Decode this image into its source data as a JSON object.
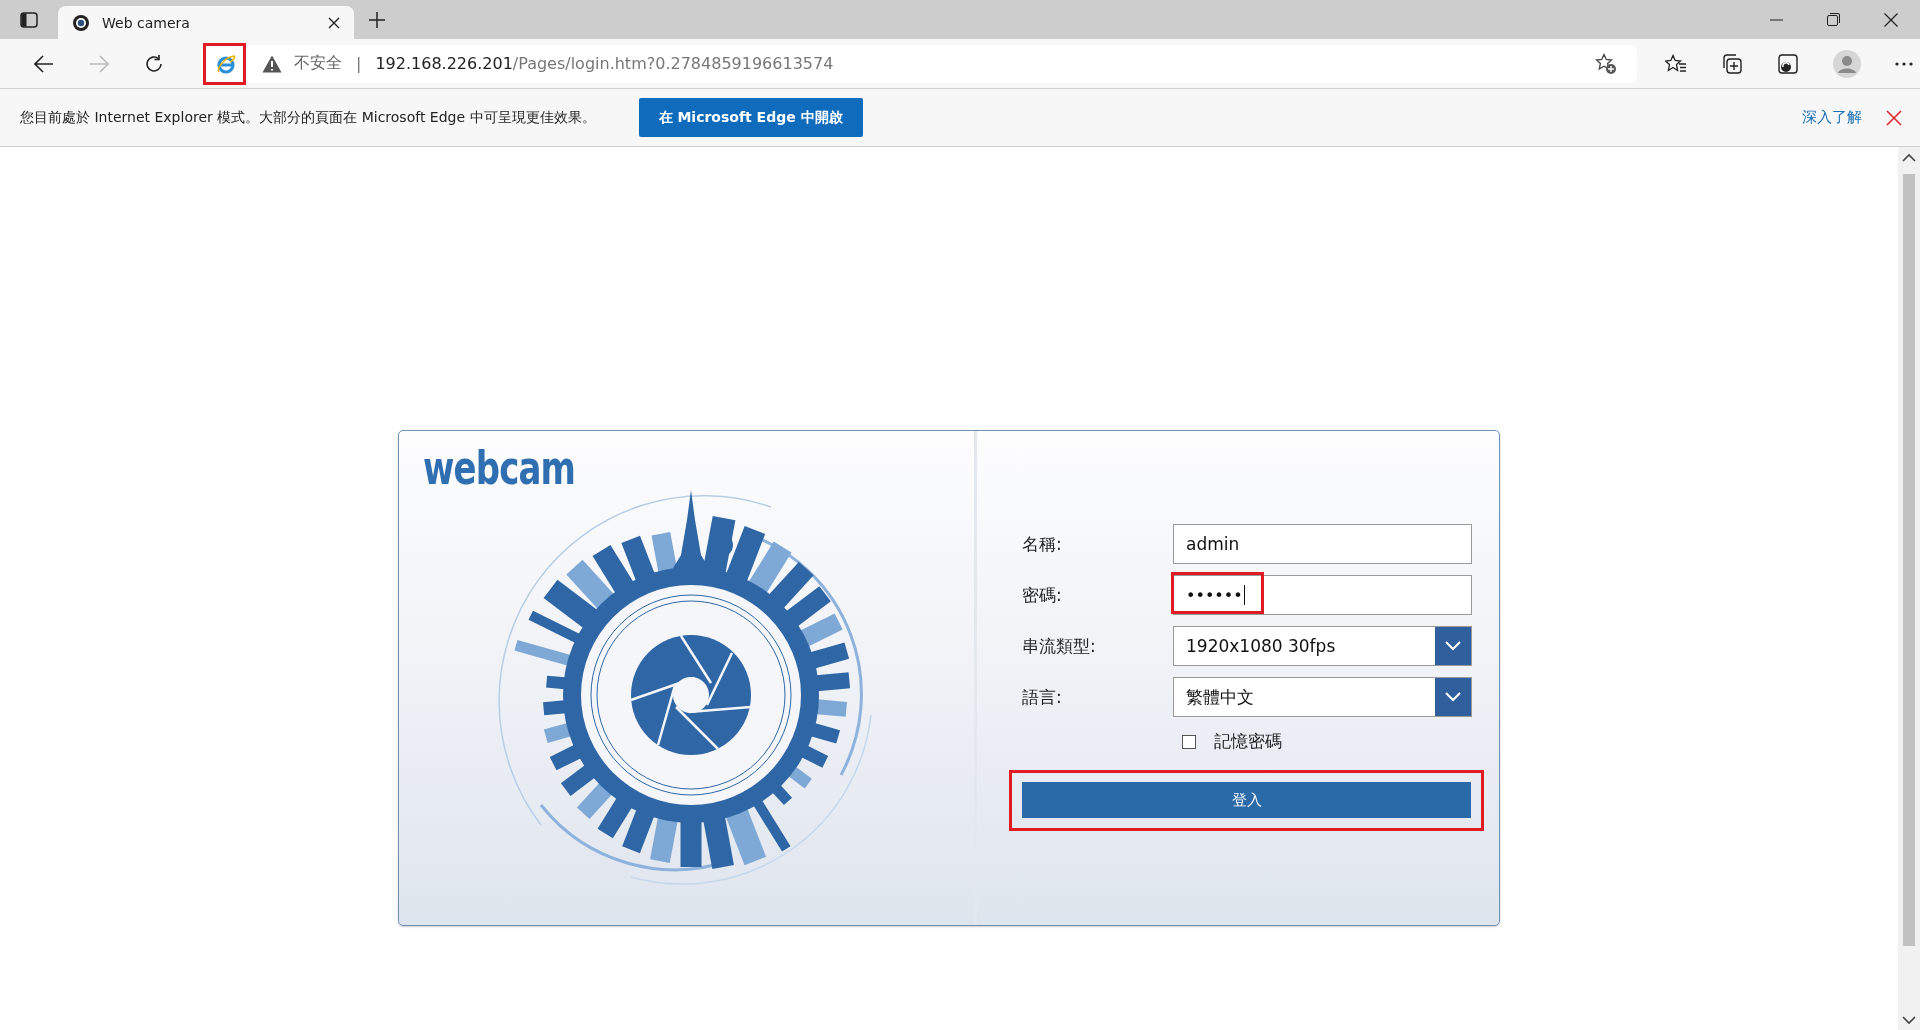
{
  "tabs": [
    {
      "title": "Web camera",
      "selected": true
    }
  ],
  "address_bar": {
    "security": "不安全",
    "separator": "|",
    "host": "192.168.226.201",
    "path": "/Pages/login.htm?0.2784859196613574",
    "ie_icon_highlighted": true
  },
  "info_bar": {
    "message": "您目前處於 Internet Explorer 模式。大部分的頁面在 Microsoft Edge 中可呈現更佳效果。",
    "open_button": "在 Microsoft Edge 中開啟",
    "learn_more": "深入了解"
  },
  "login": {
    "logo": "webcam",
    "fields": [
      {
        "label": "名稱:",
        "kind": "text",
        "value": "admin",
        "highlighted": false
      },
      {
        "label": "密碼:",
        "kind": "password",
        "value": "••••••",
        "highlighted": true
      },
      {
        "label": "串流類型:",
        "kind": "select",
        "value": "1920x1080 30fps",
        "highlighted": false
      },
      {
        "label": "語言:",
        "kind": "select",
        "value": "繁體中文",
        "highlighted": false
      }
    ],
    "remember": {
      "label": "記憶密碼",
      "checked": false
    },
    "login_button": {
      "label": "登入",
      "highlighted": true
    }
  }
}
